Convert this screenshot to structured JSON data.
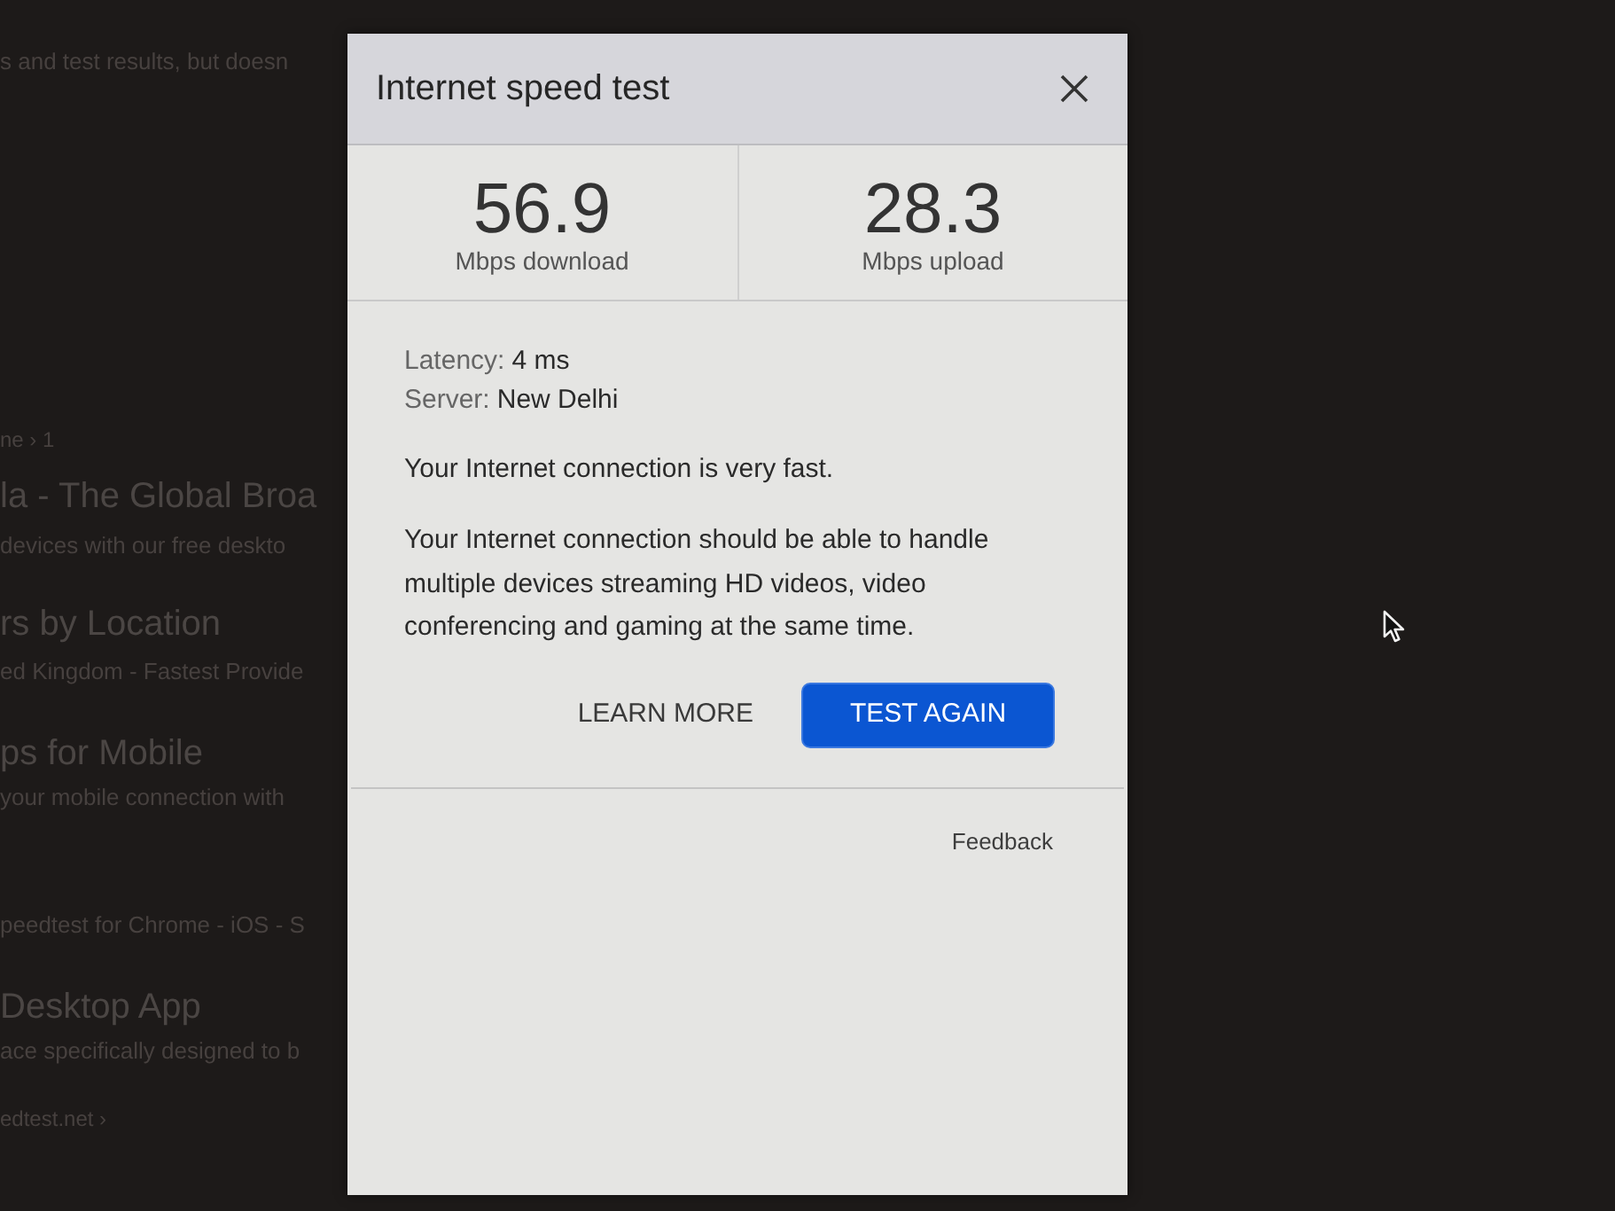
{
  "background_page": {
    "lines": [
      {
        "kind": "snippet",
        "text": "s and test results, but doesn"
      },
      {
        "kind": "url",
        "text": "ne › 1"
      },
      {
        "kind": "heading",
        "text": "la - The Global Broa"
      },
      {
        "kind": "snippet",
        "text": "devices with our free deskto"
      },
      {
        "kind": "heading",
        "text": "rs by Location"
      },
      {
        "kind": "snippet",
        "text": "ed Kingdom - Fastest Provide"
      },
      {
        "kind": "heading",
        "text": "ps for Mobile"
      },
      {
        "kind": "snippet",
        "text": "your mobile connection with"
      },
      {
        "kind": "snippet",
        "text": "peedtest for Chrome - iOS - S"
      },
      {
        "kind": "heading",
        "text": "Desktop App"
      },
      {
        "kind": "snippet",
        "text": "ace specifically designed to b"
      },
      {
        "kind": "url",
        "text": "edtest.net ›"
      }
    ]
  },
  "dialog": {
    "title": "Internet speed test",
    "stats": [
      {
        "value": "56.9",
        "label": "Mbps download"
      },
      {
        "value": "28.3",
        "label": "Mbps upload"
      }
    ],
    "details": [
      {
        "label": "Latency:",
        "value": "4 ms"
      },
      {
        "label": "Server:",
        "value": "New Delhi"
      }
    ],
    "summary": "Your Internet connection is very fast.",
    "description": "Your Internet connection should be able to handle multiple devices streaming HD videos, video conferencing and gaming at the same time.",
    "actions": [
      {
        "kind": "text",
        "label": "LEARN MORE"
      },
      {
        "kind": "primary",
        "label": "TEST AGAIN"
      }
    ],
    "feedback": "Feedback"
  }
}
